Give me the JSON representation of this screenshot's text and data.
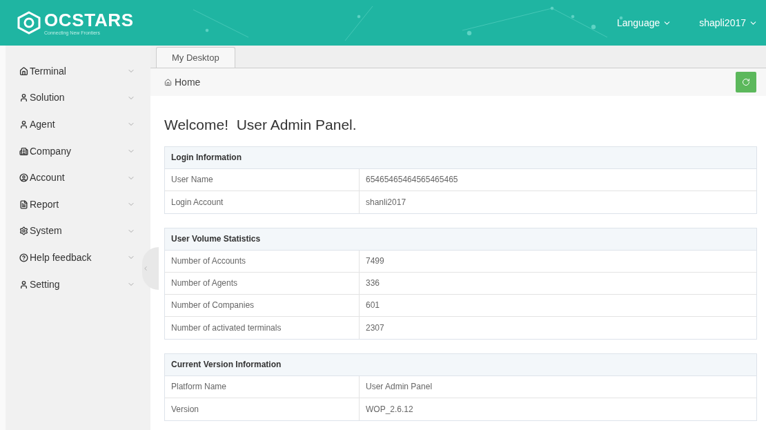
{
  "header": {
    "logo": "OCSTARS",
    "tagline": "Connecting New Frontiers",
    "language": "Language",
    "user": "shapli2017"
  },
  "sidebar": {
    "items": [
      {
        "label": "Terminal",
        "expanded": false
      },
      {
        "label": "Solution",
        "expanded": false
      },
      {
        "label": "Agent",
        "expanded": false
      },
      {
        "label": "Company",
        "expanded": false
      },
      {
        "label": "Account",
        "expanded": false
      },
      {
        "label": "Report",
        "expanded": false
      },
      {
        "label": "System",
        "expanded": false
      },
      {
        "label": "Help feedback",
        "expanded": false
      },
      {
        "label": "Setting",
        "expanded": false
      }
    ]
  },
  "tabs": [
    {
      "label": "My Desktop",
      "selected": true
    }
  ],
  "breadcrumb": "Home",
  "welcome": "Welcome!  User Admin Panel.",
  "sections": [
    {
      "title": "Login Information",
      "rows": [
        {
          "label": "User Name",
          "value": "65465465464565465465"
        },
        {
          "label": "Login Account",
          "value": "shanli2017"
        }
      ]
    },
    {
      "title": "User Volume Statistics",
      "rows": [
        {
          "label": "Number of Accounts",
          "value": "7499"
        },
        {
          "label": "Number of Agents",
          "value": "336"
        },
        {
          "label": "Number of Companies",
          "value": "601"
        },
        {
          "label": "Number of activated terminals",
          "value": "2307"
        }
      ]
    },
    {
      "title": "Current Version Information",
      "rows": [
        {
          "label": "Platform Name",
          "value": "User Admin Panel"
        },
        {
          "label": "Version",
          "value": "WOP_2.6.12"
        }
      ]
    }
  ]
}
